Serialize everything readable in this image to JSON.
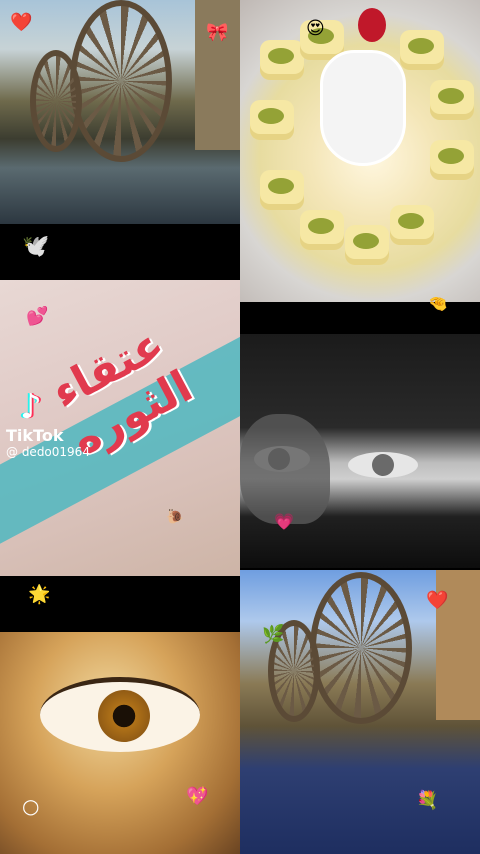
{
  "watermark": {
    "brand": "TikTok",
    "username": "@ dedo01964",
    "logo_icon": "tiktok-note-icon"
  },
  "tiles": {
    "calligraphy_text": "عتقاء الثوره"
  },
  "stickers": {
    "heart_top_left": "❤️",
    "bow": "🎀",
    "heart_eyes": "😍",
    "dove": "🕊️",
    "pink_hearts": "💕",
    "hand": "🤏",
    "snail": "🐌",
    "pink_heart_small": "💗",
    "star": "🌟",
    "bubbles": "○",
    "sparkle_heart": "💖",
    "red_heart_right": "❤️",
    "leaf": "🌿",
    "bouquet": "💐"
  }
}
